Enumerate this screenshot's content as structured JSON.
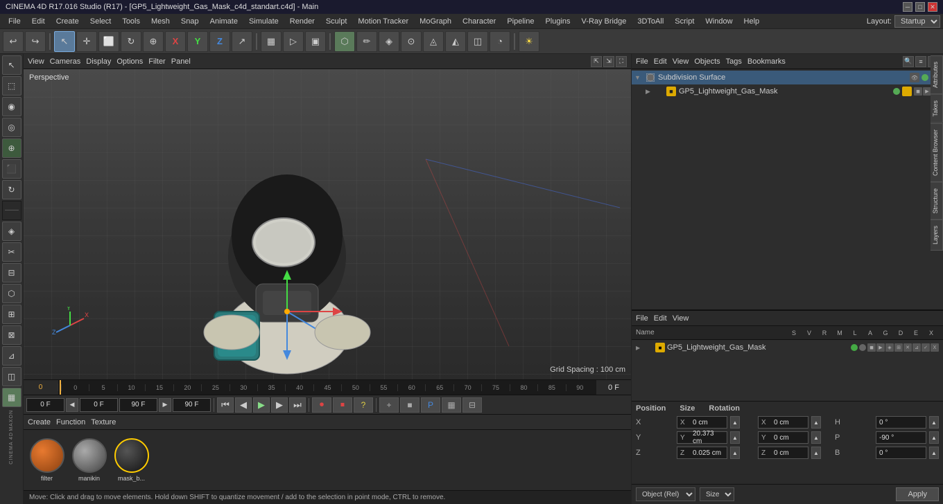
{
  "titleBar": {
    "title": "CINEMA 4D R17.016 Studio (R17) - [GP5_Lightweight_Gas_Mask_c4d_standart.c4d] - Main",
    "minimize": "─",
    "maximize": "□",
    "close": "✕"
  },
  "menuBar": {
    "items": [
      "File",
      "Edit",
      "Create",
      "Select",
      "Tools",
      "Mesh",
      "Snap",
      "Animate",
      "Simulate",
      "Render",
      "Sculpt",
      "Motion Tracker",
      "MoGraph",
      "Character",
      "Pipeline",
      "Plugins",
      "V-Ray Bridge",
      "3DToAll",
      "Script",
      "Window",
      "Help"
    ],
    "layout_label": "Layout:",
    "layout_value": "Startup"
  },
  "toolbar": {
    "undo_icon": "↩",
    "redo_icon": "↪"
  },
  "viewport": {
    "perspective_label": "Perspective",
    "grid_spacing_label": "Grid Spacing : 100 cm",
    "menuItems": [
      "View",
      "Cameras",
      "Display",
      "Options",
      "Filter",
      "Panel"
    ]
  },
  "timeline": {
    "ticks": [
      "0",
      "5",
      "10",
      "15",
      "20",
      "25",
      "30",
      "35",
      "40",
      "45",
      "50",
      "55",
      "60",
      "65",
      "70",
      "75",
      "80",
      "85",
      "90"
    ],
    "frame_display": "0 F",
    "current_frame_start": "0 F",
    "current_frame_field": "0 F",
    "end_frame": "90 F",
    "end_frame2": "90 F"
  },
  "transport": {
    "record_btn": "⏺",
    "stop_btn": "⏹",
    "question_btn": "?",
    "rewind_btn": "⏪",
    "prev_btn": "◀",
    "play_btn": "▶",
    "next_btn": "▶",
    "ffwd_btn": "⏩",
    "end_btn": "⏭",
    "special_btns": [
      "+",
      "■",
      "P",
      "▦",
      "⊟"
    ]
  },
  "materials": {
    "toolbar": [
      "Create",
      "Function",
      "Texture"
    ],
    "items": [
      {
        "name": "filter",
        "type": "orange"
      },
      {
        "name": "manikin",
        "type": "gray"
      },
      {
        "name": "mask_b...",
        "type": "dark",
        "selected": true
      }
    ]
  },
  "statusBar": {
    "text": "Move: Click and drag to move elements. Hold down SHIFT to quantize movement / add to the selection in point mode, CTRL to remove."
  },
  "objectManager": {
    "menuItems": [
      "File",
      "Edit",
      "View",
      "Objects",
      "Tags",
      "Bookmarks"
    ],
    "searchIcon": "🔍",
    "objects": [
      {
        "name": "Subdivision Surface",
        "type": "subdivision",
        "indent": 0,
        "expanded": true
      },
      {
        "name": "GP5_Lightweight_Gas_Mask",
        "type": "object",
        "indent": 1,
        "expanded": false
      }
    ]
  },
  "propertiesPanel": {
    "menuItems": [
      "File",
      "Edit",
      "View"
    ],
    "headers": {
      "name": "Name",
      "cols": [
        "S",
        "V",
        "R",
        "M",
        "L",
        "A",
        "G",
        "D",
        "E",
        "X"
      ]
    },
    "items": [
      {
        "name": "GP5_Lightweight_Gas_Mask",
        "indent": 0,
        "selected": false
      }
    ]
  },
  "transform": {
    "headers": [
      "Position",
      "Size",
      "Rotation"
    ],
    "rows": [
      {
        "label": "X",
        "pos_val": "0 cm",
        "pos_unit": "X",
        "size_val": "0 cm",
        "size_unit": "X",
        "rot_label": "H",
        "rot_val": "0 °"
      },
      {
        "label": "Y",
        "pos_val": "20.373 cm",
        "pos_unit": "Y",
        "size_val": "0 cm",
        "size_unit": "Y",
        "rot_label": "P",
        "rot_val": "-90 °"
      },
      {
        "label": "Z",
        "pos_val": "0.025 cm",
        "pos_unit": "Z",
        "size_val": "0 cm",
        "size_unit": "Z",
        "rot_label": "B",
        "rot_val": "0 °"
      }
    ],
    "object_label": "Object (Rel)",
    "size_label": "Size",
    "apply_label": "Apply"
  },
  "rightTabs": [
    "Attributes",
    "Takes",
    "Content Browser",
    "Structure",
    "Layers"
  ]
}
